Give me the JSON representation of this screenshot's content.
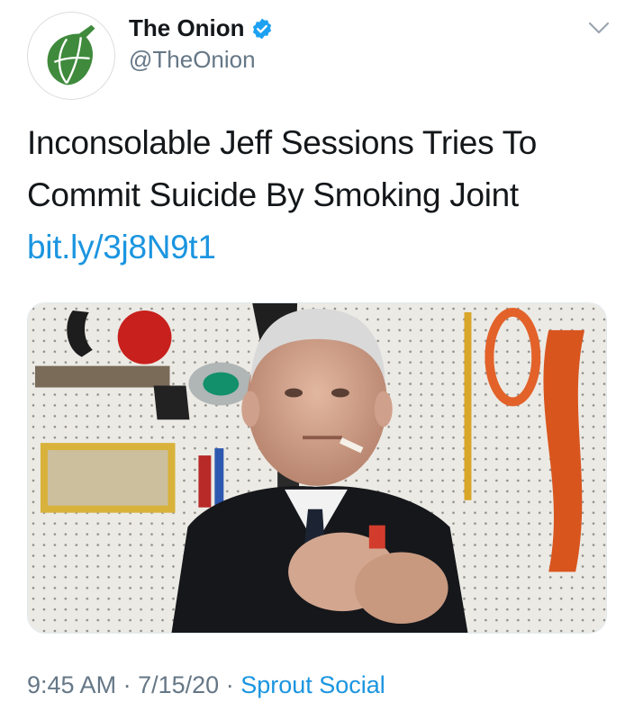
{
  "tweet": {
    "author": {
      "name": "The Onion",
      "handle": "@TheOnion",
      "verified": true
    },
    "text_lines": [
      "Inconsolable Jeff Sessions Tries To",
      "Commit Suicide By Smoking Joint"
    ],
    "link": "bit.ly/3j8N9t1",
    "timestamp_time": "9:45 AM",
    "separator": "·",
    "timestamp_date": "7/15/20",
    "source": "Sprout Social"
  },
  "icons": {
    "avatar": "onion-logo-icon",
    "verified": "verified-badge-icon",
    "menu": "chevron-down-icon"
  },
  "colors": {
    "link": "#1b95e0",
    "secondary_text": "#657786",
    "verified_blue": "#1da1f2",
    "onion_green": "#3f8a3c"
  }
}
